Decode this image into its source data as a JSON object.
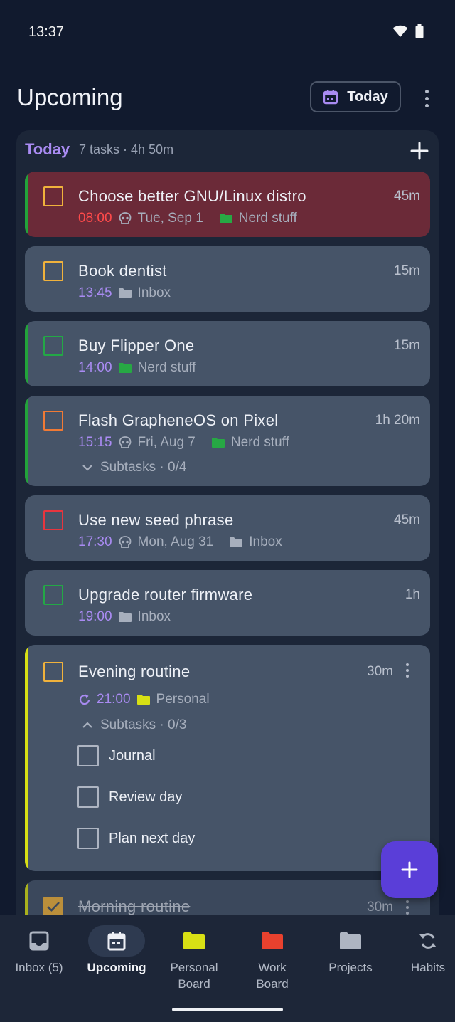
{
  "status": {
    "time": "13:37"
  },
  "header": {
    "title": "Upcoming",
    "today_button": "Today"
  },
  "section": {
    "title": "Today",
    "meta": "7 tasks · 4h 50m"
  },
  "tasks": [
    {
      "title": "Choose better GNU/Linux distro",
      "duration": "45m",
      "time": "08:00",
      "deadline": "Tue, Sep 1",
      "folder": "Nerd stuff",
      "accent": "#22a33a",
      "check_color": "#f0b23c",
      "folder_color": "#27a844",
      "overdue": true
    },
    {
      "title": "Book dentist",
      "duration": "15m",
      "time": "13:45",
      "folder": "Inbox",
      "check_color": "#f0b23c",
      "folder_color": "#a7afbd"
    },
    {
      "title": "Buy Flipper One",
      "duration": "15m",
      "time": "14:00",
      "folder": "Nerd stuff",
      "accent": "#22a33a",
      "check_color": "#23a846",
      "folder_color": "#27a844"
    },
    {
      "title": "Flash GrapheneOS on Pixel",
      "duration": "1h 20m",
      "time": "15:15",
      "deadline": "Fri, Aug 7",
      "folder": "Nerd stuff",
      "subtasks": "Subtasks · 0/4",
      "accent": "#22a33a",
      "check_color": "#f07a35",
      "folder_color": "#27a844"
    },
    {
      "title": "Use new seed phrase",
      "duration": "45m",
      "time": "17:30",
      "deadline": "Mon, Aug 31",
      "folder": "Inbox",
      "check_color": "#e8353e",
      "folder_color": "#a7afbd"
    },
    {
      "title": "Upgrade router firmware",
      "duration": "1h",
      "time": "19:00",
      "folder": "Inbox",
      "check_color": "#23a846",
      "folder_color": "#a7afbd"
    },
    {
      "title": "Evening routine",
      "duration": "30m",
      "time": "21:00",
      "folder": "Personal",
      "subtasks": "Subtasks · 0/3",
      "accent": "#d8e014",
      "check_color": "#f0b23c",
      "folder_color": "#d8e014",
      "subtask_items": [
        "Journal",
        "Review day",
        "Plan next day"
      ]
    },
    {
      "title": "Morning routine",
      "duration": "30m",
      "accent": "#d8e014",
      "check_color": "#f0b23c",
      "done": true
    }
  ],
  "nav": [
    {
      "label": "Inbox (5)",
      "icon": "inbox-icon"
    },
    {
      "label": "Upcoming",
      "icon": "calendar-icon",
      "active": true
    },
    {
      "label": "Personal\nBoard",
      "icon": "folder-icon",
      "color": "#d8e014"
    },
    {
      "label": "Work\nBoard",
      "icon": "folder-icon",
      "color": "#e8412e"
    },
    {
      "label": "Projects",
      "icon": "folder-icon",
      "color": "#aeb5c2"
    },
    {
      "label": "Habits",
      "icon": "repeat-icon"
    }
  ]
}
